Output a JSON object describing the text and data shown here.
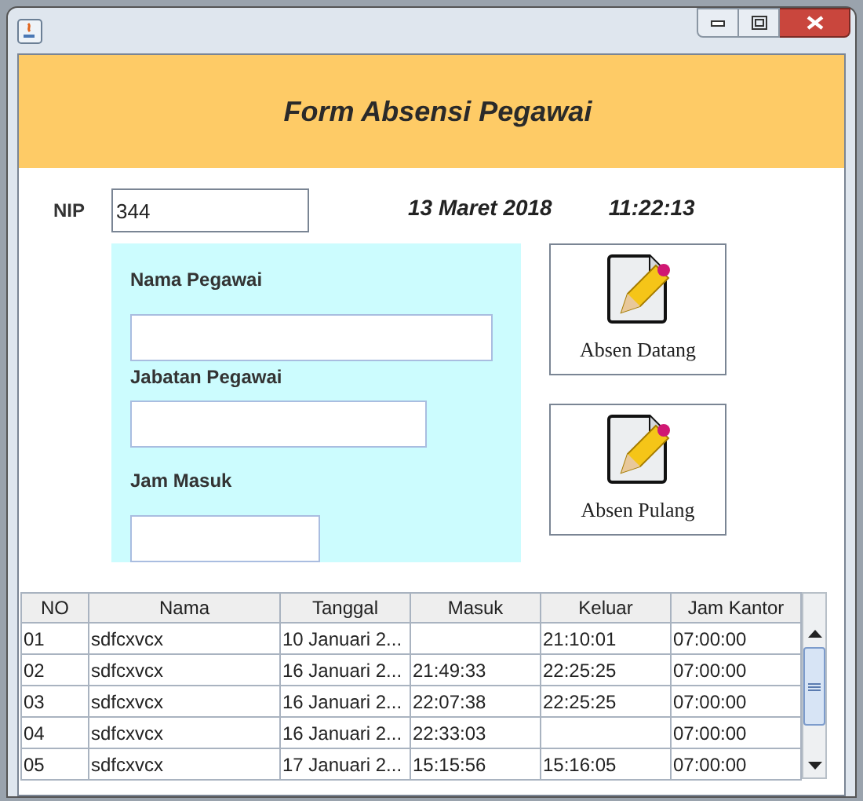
{
  "header": {
    "title": "Form Absensi Pegawai"
  },
  "nip": {
    "label": "NIP",
    "value": "344"
  },
  "date": "13 Maret 2018",
  "time": "11:22:13",
  "employee_panel": {
    "fields": [
      {
        "label": "Nama Pegawai"
      },
      {
        "label": "Jabatan Pegawai"
      },
      {
        "label": "Jam Masuk"
      }
    ]
  },
  "buttons": [
    {
      "label": "Absen Datang"
    },
    {
      "label": "Absen Pulang"
    }
  ],
  "table": {
    "columns": [
      "NO",
      "Nama",
      "Tanggal",
      "Masuk",
      "Keluar",
      "Jam Kantor"
    ],
    "rows": [
      [
        "01",
        "sdfcxvcx",
        "10 Januari 2...",
        null,
        "21:10:01",
        "07:00:00"
      ],
      [
        "02",
        "sdfcxvcx",
        "16 Januari 2...",
        "21:49:33",
        "22:25:25",
        "07:00:00"
      ],
      [
        "03",
        "sdfcxvcx",
        "16 Januari 2...",
        "22:07:38",
        "22:25:25",
        "07:00:00"
      ],
      [
        "04",
        "sdfcxvcx",
        "16 Januari 2...",
        "22:33:03",
        null,
        "07:00:00"
      ],
      [
        "05",
        "sdfcxvcx",
        "17 Januari 2...",
        "15:15:56",
        "15:16:05",
        "07:00:00"
      ]
    ]
  }
}
